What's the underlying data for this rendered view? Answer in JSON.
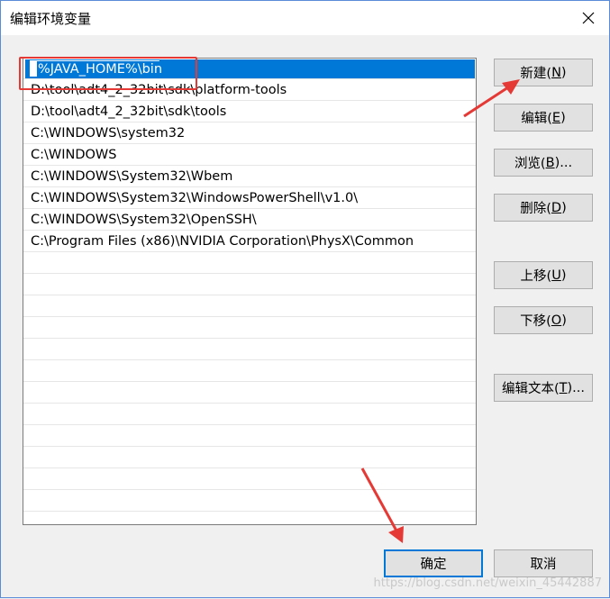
{
  "window": {
    "title": "编辑环境变量",
    "close_icon": "close-icon"
  },
  "list": {
    "items": [
      "%JAVA_HOME%\\bin",
      "D:\\tool\\adt4_2_32bit\\sdk\\platform-tools",
      "D:\\tool\\adt4_2_32bit\\sdk\\tools",
      "C:\\WINDOWS\\system32",
      "C:\\WINDOWS",
      "C:\\WINDOWS\\System32\\Wbem",
      "C:\\WINDOWS\\System32\\WindowsPowerShell\\v1.0\\",
      "C:\\WINDOWS\\System32\\OpenSSH\\",
      "C:\\Program Files (x86)\\NVIDIA Corporation\\PhysX\\Common"
    ],
    "editing_index": 0
  },
  "buttons": {
    "new": {
      "label": "新建(",
      "mnemonic": "N",
      "suffix": ")"
    },
    "edit": {
      "label": "编辑(",
      "mnemonic": "E",
      "suffix": ")"
    },
    "browse": {
      "label": "浏览(",
      "mnemonic": "B",
      "suffix": ")..."
    },
    "delete": {
      "label": "删除(",
      "mnemonic": "D",
      "suffix": ")"
    },
    "move_up": {
      "label": "上移(",
      "mnemonic": "U",
      "suffix": ")"
    },
    "move_down": {
      "label": "下移(",
      "mnemonic": "O",
      "suffix": ")"
    },
    "edit_text": {
      "label": "编辑文本(",
      "mnemonic": "T",
      "suffix": ")..."
    },
    "ok": {
      "label": "确定"
    },
    "cancel": {
      "label": "取消"
    }
  },
  "annotation_color": "#e53935",
  "accent_color": "#0078d7",
  "watermark": "https://blog.csdn.net/weixin_45442887"
}
